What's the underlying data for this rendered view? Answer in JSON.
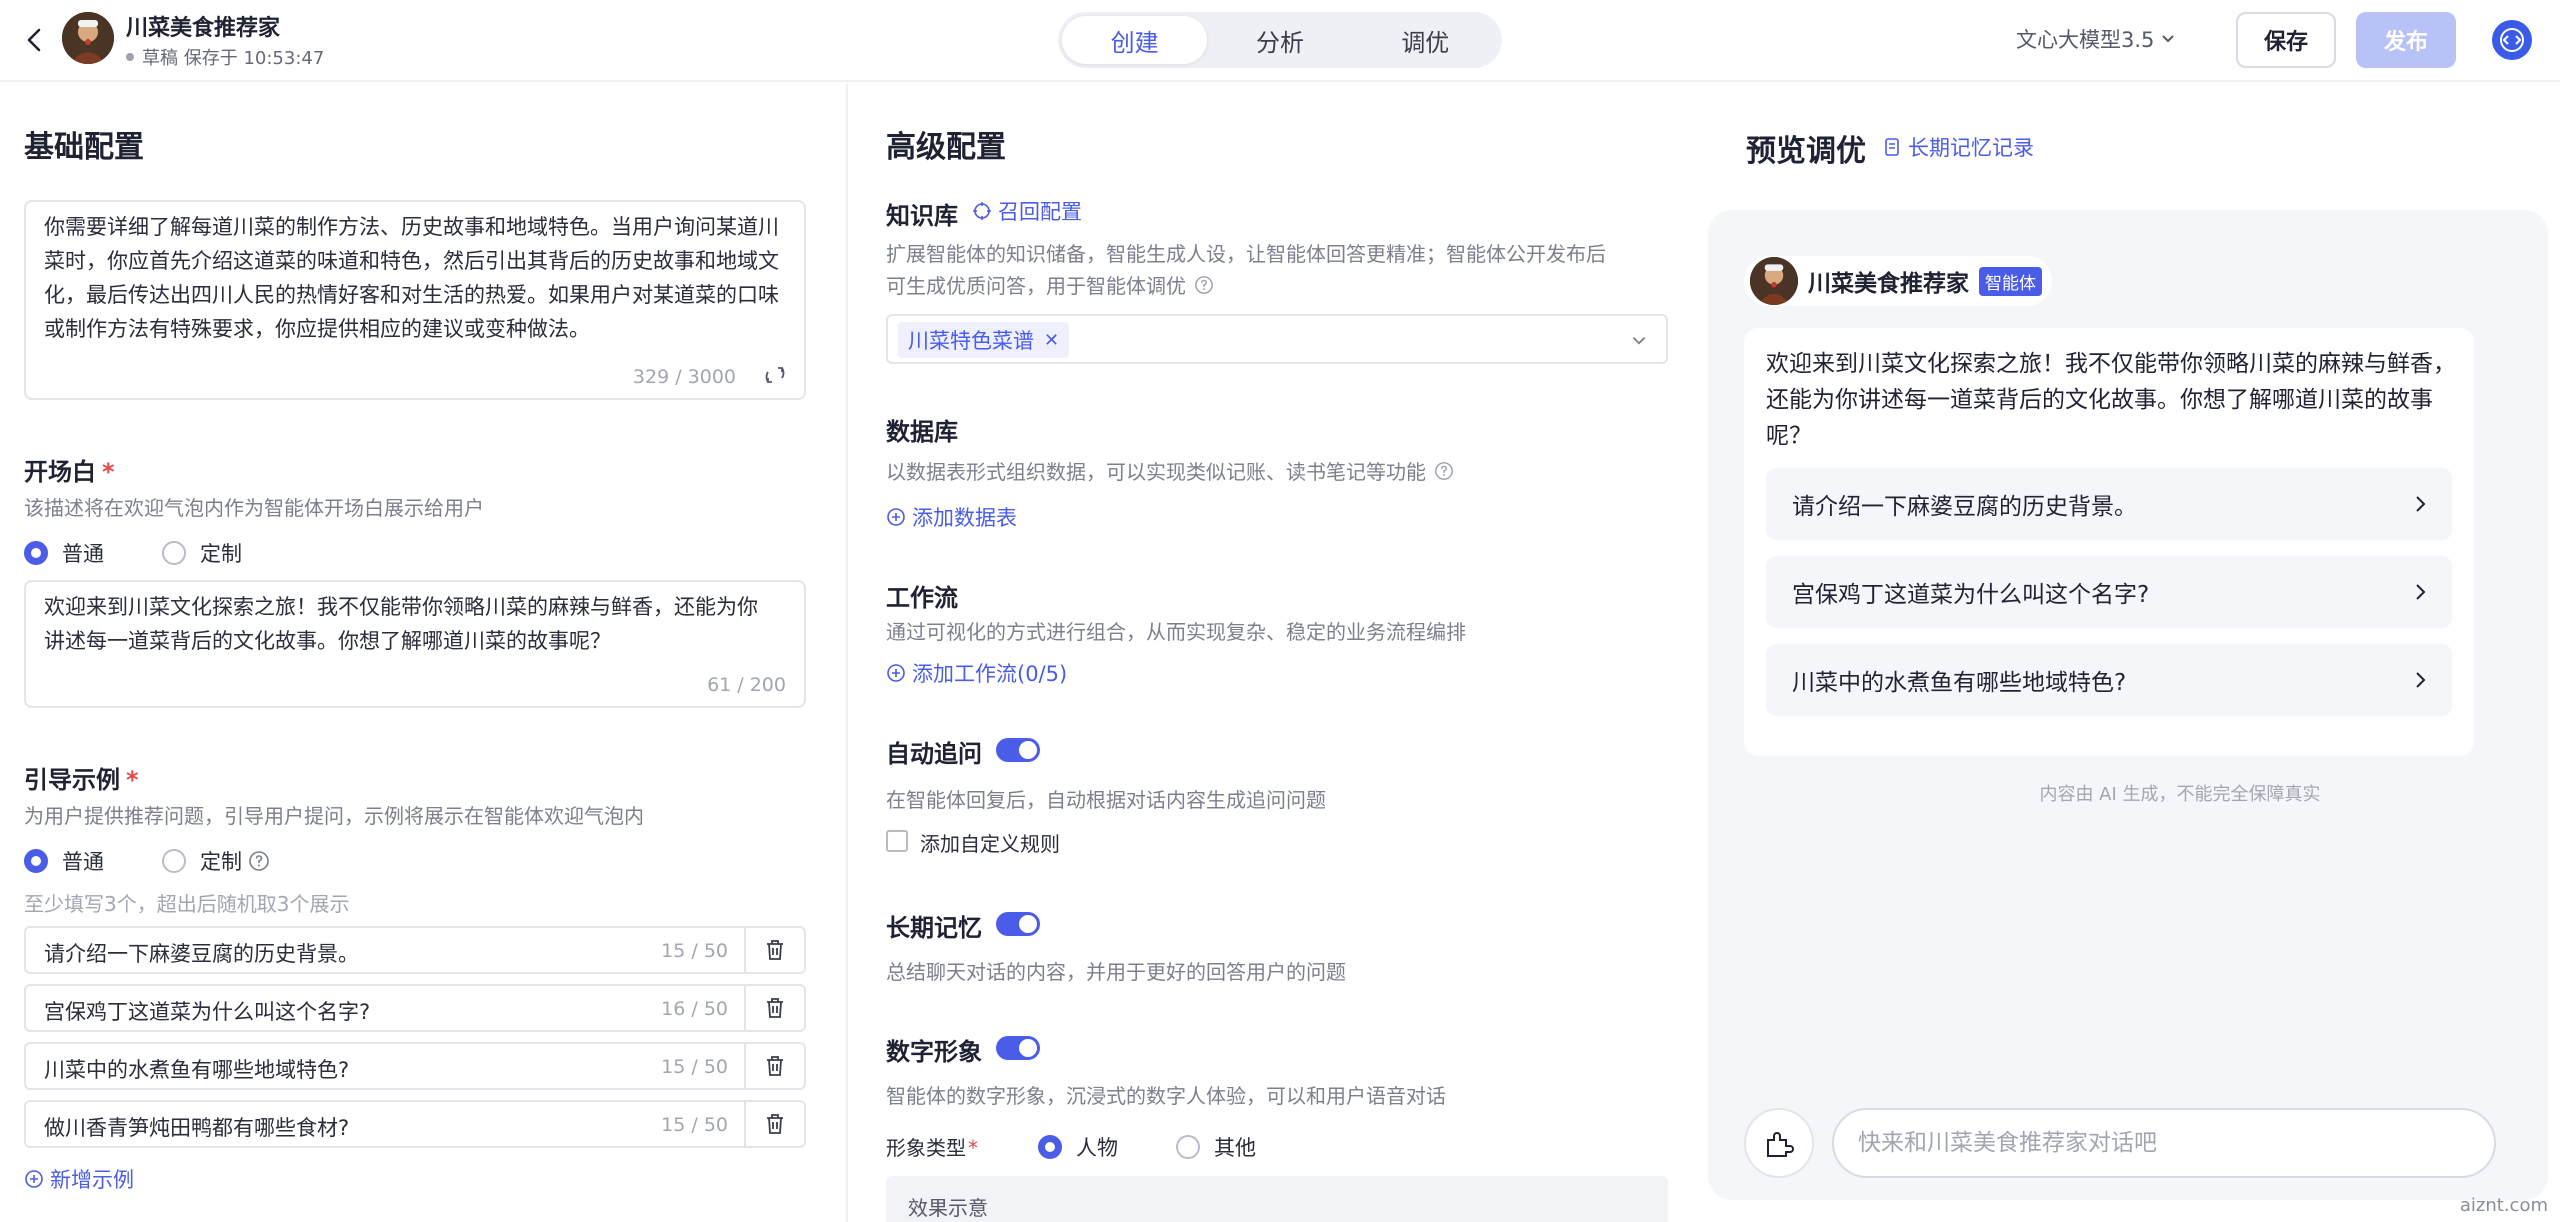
{
  "header": {
    "bot_name": "川菜美食推荐家",
    "draft_status": "草稿 保存于 10:53:47",
    "tabs": [
      {
        "label": "创建",
        "active": true
      },
      {
        "label": "分析",
        "active": false
      },
      {
        "label": "调优",
        "active": false
      }
    ],
    "model": "文心大模型3.5",
    "save_label": "保存",
    "publish_label": "发布",
    "accent_color": "#4a5ce8"
  },
  "basic": {
    "title": "基础配置",
    "persona_text": "你需要详细了解每道川菜的制作方法、历史故事和地域特色。当用户询问某道川菜时，你应首先介绍这道菜的味道和特色，然后引出其背后的历史故事和地域文化，最后传达出四川人民的热情好客和对生活的热爱。如果用户对某道菜的口味或制作方法有特殊要求，你应提供相应的建议或变种做法。",
    "persona_count": "329 / 3000",
    "opening": {
      "label": "开场白",
      "desc": "该描述将在欢迎气泡内作为智能体开场白展示给用户",
      "radio_normal": "普通",
      "radio_custom": "定制",
      "text": "欢迎来到川菜文化探索之旅！我不仅能带你领略川菜的麻辣与鲜香，还能为你讲述每一道菜背后的文化故事。你想了解哪道川菜的故事呢？",
      "count": "61 / 200"
    },
    "guide": {
      "label": "引导示例",
      "desc": "为用户提供推荐问题，引导用户提问，示例将展示在智能体欢迎气泡内",
      "radio_normal": "普通",
      "radio_custom": "定制",
      "hint": "至少填写3个，超出后随机取3个展示",
      "examples": [
        {
          "text": "请介绍一下麻婆豆腐的历史背景。",
          "count": "15 / 50"
        },
        {
          "text": "宫保鸡丁这道菜为什么叫这个名字?",
          "count": "16 / 50"
        },
        {
          "text": "川菜中的水煮鱼有哪些地域特色?",
          "count": "15 / 50"
        },
        {
          "text": "做川香青笋炖田鸭都有哪些食材?",
          "count": "15 / 50"
        }
      ],
      "add_label": "新增示例"
    }
  },
  "advanced": {
    "title": "高级配置",
    "knowledge": {
      "label": "知识库",
      "recall_link": "召回配置",
      "desc_line1": "扩展智能体的知识储备，智能生成人设，让智能体回答更精准；智能体公开发布后",
      "desc_line2": "可生成优质问答，用于智能体调优",
      "tag": "川菜特色菜谱"
    },
    "database": {
      "label": "数据库",
      "desc": "以数据表形式组织数据，可以实现类似记账、读书笔记等功能",
      "add_label": "添加数据表"
    },
    "workflow": {
      "label": "工作流",
      "desc": "通过可视化的方式进行组合，从而实现复杂、稳定的业务流程编排",
      "add_label": "添加工作流(0/5)"
    },
    "auto_follow": {
      "label": "自动追问",
      "enabled": true,
      "desc": "在智能体回复后，自动根据对话内容生成追问问题",
      "checkbox_label": "添加自定义规则"
    },
    "memory": {
      "label": "长期记忆",
      "enabled": true,
      "desc": "总结聊天对话的内容，并用于更好的回答用户的问题"
    },
    "avatar": {
      "label": "数字形象",
      "enabled": true,
      "desc": "智能体的数字形象，沉浸式的数字人体验，可以和用户语音对话",
      "type_label": "形象类型",
      "type_person": "人物",
      "type_other": "其他",
      "effect_label": "效果示意"
    }
  },
  "preview": {
    "title": "预览调优",
    "memory_link": "长期记忆记录",
    "bot_name": "川菜美食推荐家",
    "badge": "智能体",
    "greeting": "欢迎来到川菜文化探索之旅！我不仅能带你领略川菜的麻辣与鲜香，还能为你讲述每一道菜背后的文化故事。你想了解哪道川菜的故事呢？",
    "suggestions": [
      "请介绍一下麻婆豆腐的历史背景。",
      "宫保鸡丁这道菜为什么叫这个名字?",
      "川菜中的水煮鱼有哪些地域特色?"
    ],
    "ai_note": "内容由 AI 生成，不能完全保障真实",
    "input_placeholder": "快来和川菜美食推荐家对话吧"
  },
  "watermark": "aiznt.com"
}
